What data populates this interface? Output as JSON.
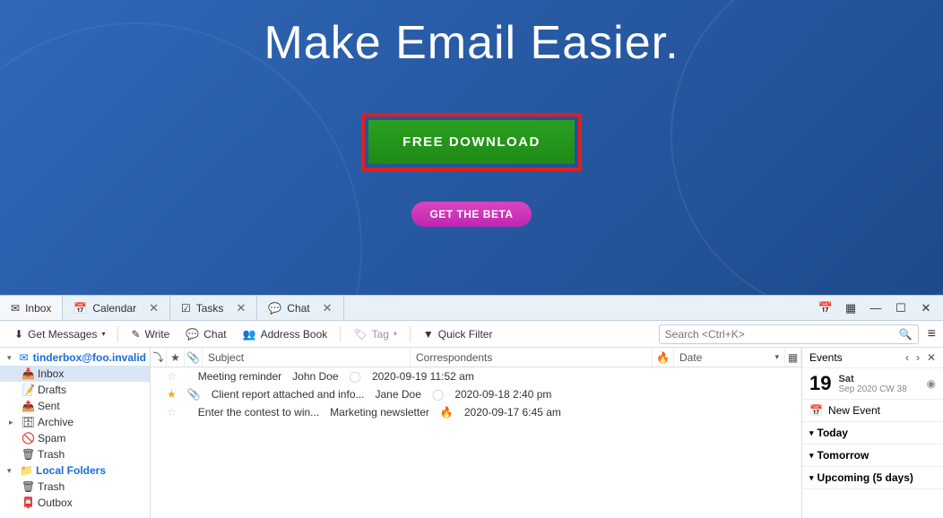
{
  "hero": {
    "headline": "Make Email Easier.",
    "download_label": "FREE DOWNLOAD",
    "beta_label": "GET THE BETA"
  },
  "tabs": [
    {
      "icon": "mail",
      "label": "Inbox",
      "closable": false,
      "active": true
    },
    {
      "icon": "calendar",
      "label": "Calendar",
      "closable": true
    },
    {
      "icon": "tasks",
      "label": "Tasks",
      "closable": true
    },
    {
      "icon": "chat",
      "label": "Chat",
      "closable": true
    }
  ],
  "toolbar": {
    "get_messages": "Get Messages",
    "write": "Write",
    "chat": "Chat",
    "address_book": "Address Book",
    "tag": "Tag",
    "quick_filter": "Quick Filter",
    "search_placeholder": "Search <Ctrl+K>"
  },
  "folders": {
    "account": "tinderbox@foo.invalid",
    "items": [
      {
        "label": "Inbox",
        "ico": "📥",
        "sel": true
      },
      {
        "label": "Drafts",
        "ico": "📝"
      },
      {
        "label": "Sent",
        "ico": "📤"
      },
      {
        "label": "Archive",
        "ico": "🗄",
        "exp": true
      },
      {
        "label": "Spam",
        "ico": "🚫"
      },
      {
        "label": "Trash",
        "ico": "🗑"
      }
    ],
    "local_label": "Local Folders",
    "local": [
      {
        "label": "Trash",
        "ico": "🗑"
      },
      {
        "label": "Outbox",
        "ico": "📮"
      }
    ]
  },
  "columns": {
    "subject": "Subject",
    "correspondents": "Correspondents",
    "date": "Date"
  },
  "messages": [
    {
      "star": false,
      "att": false,
      "subject": "Meeting reminder",
      "from": "John Doe",
      "hot": false,
      "date": "2020-09-19 11:52 am"
    },
    {
      "star": true,
      "att": true,
      "subject": "Client report attached and info...",
      "from": "Jane Doe",
      "hot": false,
      "date": "2020-09-18 2:40 pm"
    },
    {
      "star": false,
      "att": false,
      "subject": "Enter the contest to win...",
      "from": "Marketing newsletter",
      "hot": true,
      "date": "2020-09-17 6:45 am"
    }
  ],
  "events": {
    "title": "Events",
    "day": "19",
    "dow": "Sat",
    "sub": "Sep 2020 CW 38",
    "new_event": "New Event",
    "today": "Today",
    "tomorrow": "Tomorrow",
    "upcoming": "Upcoming (5 days)"
  }
}
